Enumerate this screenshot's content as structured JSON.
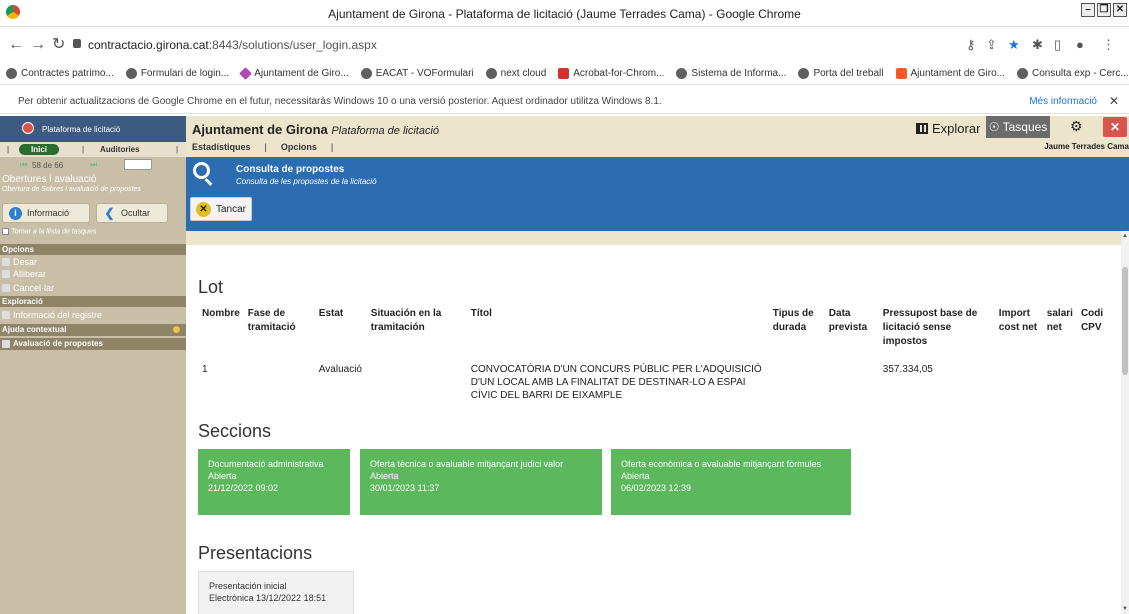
{
  "window": {
    "title": "Ajuntament de Girona - Plataforma de licitació (Jaume Terrades Cama) - Google Chrome",
    "controls": [
      "–",
      "❐",
      "✕"
    ]
  },
  "browser": {
    "url_host": "contractacio.girona.cat",
    "url_rest": ":8443/solutions/user_login.aspx",
    "bookmarks": [
      {
        "label": "Contractes patrimo...",
        "icon": "globe-icon"
      },
      {
        "label": "Formulari de login...",
        "icon": "globe-icon"
      },
      {
        "label": "Ajuntament de Giro...",
        "icon": "diamond-icon"
      },
      {
        "label": "EACAT - VOFormulari",
        "icon": "globe-icon"
      },
      {
        "label": "next cloud",
        "icon": "globe-icon"
      },
      {
        "label": "Acrobat-for-Chrom...",
        "icon": "acrobat-icon"
      },
      {
        "label": "Sistema de Informa...",
        "icon": "globe-icon"
      },
      {
        "label": "Porta del treball",
        "icon": "globe-icon"
      },
      {
        "label": "Ajuntament de Giro...",
        "icon": "orange-icon"
      },
      {
        "label": "Consulta exp - Cerc...",
        "icon": "globe-icon"
      }
    ],
    "bookmarks_overflow": "»",
    "infobar": {
      "message": "Per obtenir actualitzacions de Google Chrome en el futur, necessitaràs Windows 10 o una versió posterior. Aquest ordinador utilitza Windows 8.1.",
      "more_link": "Més informació",
      "close": "✕"
    }
  },
  "left_panel": {
    "header": "Plataforma de licitació",
    "tabs": {
      "inici": "Inici",
      "auditories": "Auditories"
    },
    "pager": "58 de 66",
    "section_title": "Obertures i avaluació",
    "section_sub": "Obertura de Sobres i avaluació de propostes",
    "btn_info": "Informació",
    "btn_hide": "Ocultar",
    "back_link": "Tornar a la llista de tasques",
    "opcions_header": "Opcions",
    "opcions": [
      "Desar",
      "Alliberar",
      "Cancel·lar"
    ],
    "exploracio_header": "Exploració",
    "exploracio": [
      "Informació del registre"
    ],
    "ajuda_header": "Ajuda contextual",
    "ajuda": [
      "Avaluació de propostes"
    ]
  },
  "appbar": {
    "title": "Ajuntament de Girona",
    "title_italic": "Plataforma de licitació",
    "menu": [
      "Estadístiques",
      "Opcions"
    ],
    "explorar": "Explorar",
    "tasques": "Tasques",
    "user": "Jaume Terrades Cama"
  },
  "header": {
    "title": "Consulta de propostes",
    "subtitle": "Consulta de les propostes de la licitació",
    "tancar": "Tancar"
  },
  "lot": {
    "heading": "Lot",
    "columns": [
      "Nombre",
      "Fase de tramitació",
      "Estat",
      "Situación en la tramitación",
      "Títol",
      "Tipus de durada",
      "Data prevista",
      "Pressupost base de licitació sense impostos",
      "Import cost net",
      "salari net",
      "Codi CPV"
    ],
    "row": {
      "nombre": "1",
      "fase": "",
      "estat": "Avaluació",
      "situacion": "",
      "titol": "CONVOCATÒRIA D'UN CONCURS PÚBLIC PER L'ADQUISICIÓ D'UN LOCAL AMB LA FINALITAT DE DESTINAR-LO A ESPAI CÍVIC DEL BARRI DE EIXAMPLE",
      "tipus": "",
      "data": "",
      "pressupost": "357.334,05",
      "import": "",
      "salari": "",
      "cpv": ""
    }
  },
  "seccions": {
    "heading": "Seccions",
    "cards": [
      {
        "title": "Documentació administrativa",
        "status": "Abierta",
        "date": "21/12/2022 09:02"
      },
      {
        "title": "Oferta tècnica o avaluable mitjançant judici valor",
        "status": "Abierta",
        "date": "30/01/2023 11:37"
      },
      {
        "title": "Oferta econòmica o avaluable mitjançant fòrmules",
        "status": "Abierta",
        "date": "06/02/2023 12:39"
      }
    ],
    "card_color": "#5cb85c"
  },
  "presentacions": {
    "heading": "Presentacions",
    "items": [
      {
        "title": "Presentación inicial",
        "detail": "Electrònica 13/12/2022 18:51"
      }
    ]
  },
  "colors": {
    "blue_header": "#2c6cb0",
    "left_panel": "#c8bfa6",
    "appbar": "#ede4cc"
  }
}
